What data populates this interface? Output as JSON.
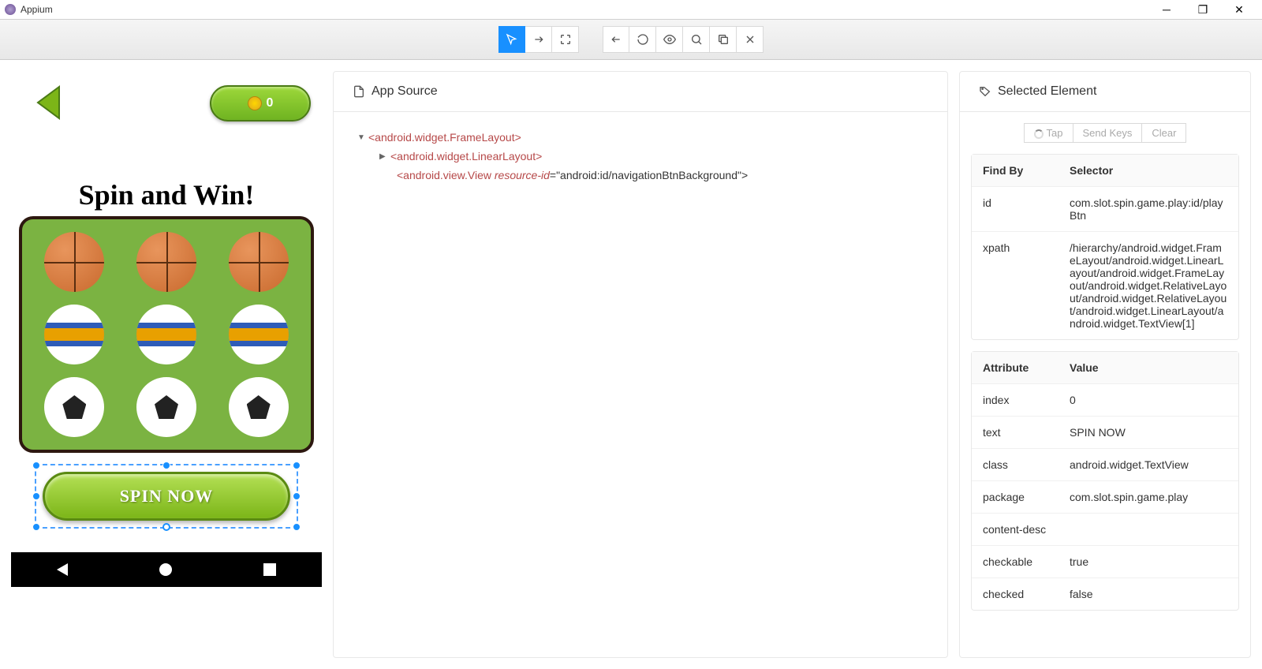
{
  "titlebar": {
    "app_name": "Appium"
  },
  "device": {
    "coin_count": "0",
    "game_title": "Spin and Win!",
    "spin_button": "SPIN NOW"
  },
  "source_panel": {
    "title": "App Source",
    "tree": {
      "node1": "<android.widget.FrameLayout>",
      "node2": "<android.widget.LinearLayout>",
      "node3_pre": "<android.view.View ",
      "node3_attr_name": "resource-id",
      "node3_attr_val": "=\"android:id/navigationBtnBackground\">"
    }
  },
  "selected_panel": {
    "title": "Selected Element",
    "actions": {
      "tap": "Tap",
      "sendkeys": "Send Keys",
      "clear": "Clear"
    },
    "findby": {
      "head_findby": "Find By",
      "head_selector": "Selector",
      "row_id_label": "id",
      "row_id_val": "com.slot.spin.game.play:id/playBtn",
      "row_xpath_label": "xpath",
      "row_xpath_val": "/hierarchy/android.widget.FrameLayout/android.widget.LinearLayout/android.widget.FrameLayout/android.widget.RelativeLayout/android.widget.RelativeLayout/android.widget.LinearLayout/android.widget.TextView[1]"
    },
    "attrs": {
      "head_attr": "Attribute",
      "head_val": "Value",
      "index_k": "index",
      "index_v": "0",
      "text_k": "text",
      "text_v": "SPIN NOW",
      "class_k": "class",
      "class_v": "android.widget.TextView",
      "package_k": "package",
      "package_v": "com.slot.spin.game.play",
      "cd_k": "content-desc",
      "cd_v": "",
      "checkable_k": "checkable",
      "checkable_v": "true",
      "checked_k": "checked",
      "checked_v": "false"
    }
  }
}
